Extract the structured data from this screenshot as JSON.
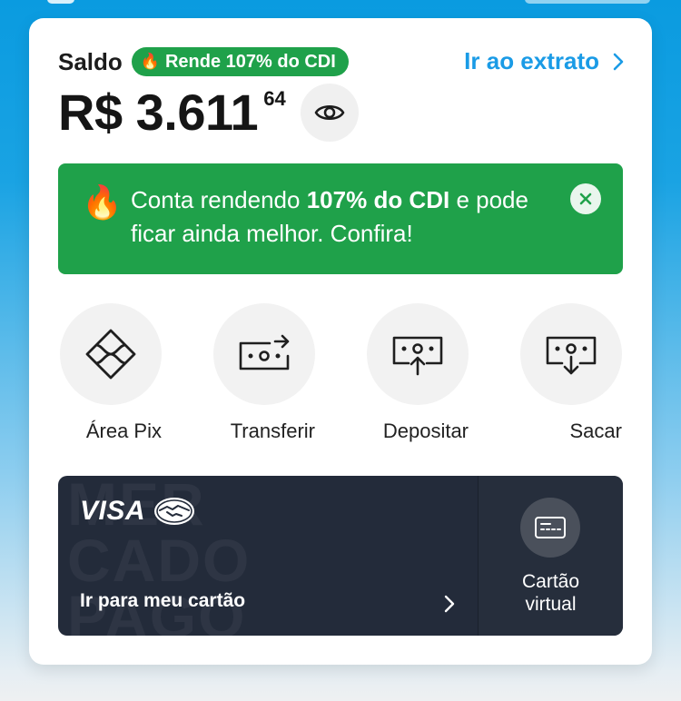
{
  "saldo": {
    "label": "Saldo",
    "yield_badge": "Rende 107% do CDI",
    "extrato_link": "Ir ao extrato",
    "balance_main": "R$ 3.611",
    "balance_cents": "64"
  },
  "promo": {
    "text_1": "Conta rendendo ",
    "text_bold": "107% do CDI",
    "text_2": " e pode ficar ainda melhor. Confira!"
  },
  "actions": [
    {
      "label": "Área Pix",
      "icon": "pix-icon"
    },
    {
      "label": "Transferir",
      "icon": "transfer-icon"
    },
    {
      "label": "Depositar",
      "icon": "deposit-icon"
    },
    {
      "label": "Sacar",
      "icon": "withdraw-icon"
    }
  ],
  "card": {
    "brand": "VISA",
    "watermark": [
      "MER",
      "CADO",
      "PAGO"
    ],
    "cta": "Ir para meu cartão",
    "virtual_line1": "Cartão",
    "virtual_line2": "virtual"
  },
  "colors": {
    "accent_blue": "#1a9be6",
    "promo_green": "#1fa14a",
    "card_dark": "#232b3a"
  }
}
